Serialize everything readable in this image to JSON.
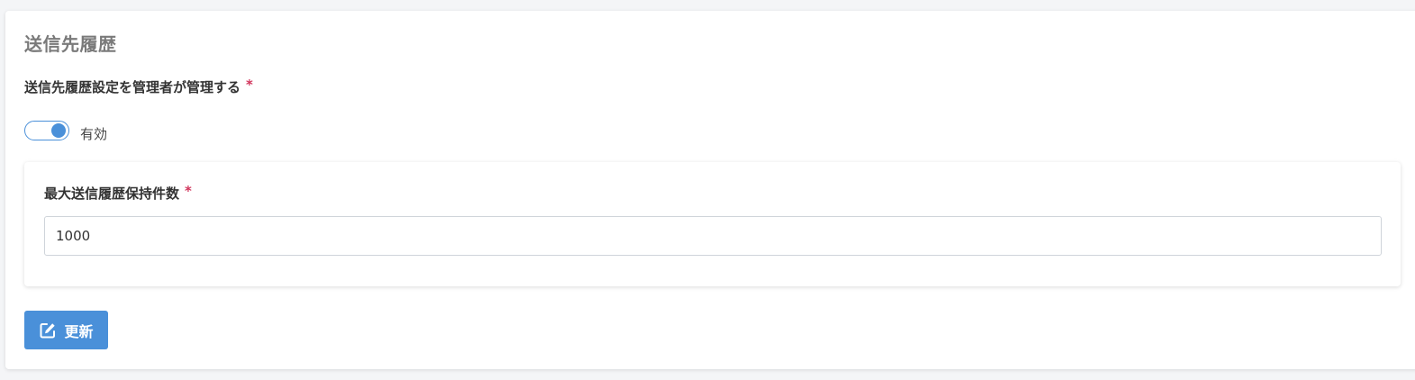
{
  "section": {
    "title": "送信先履歴"
  },
  "admin_manage": {
    "label": "送信先履歴設定を管理者が管理する",
    "required_mark": "*",
    "toggle_on": true,
    "toggle_label": "有効"
  },
  "max_history": {
    "label": "最大送信履歴保持件数",
    "required_mark": "*",
    "value": "1000"
  },
  "actions": {
    "update_label": "更新"
  },
  "colors": {
    "accent": "#4a90d9",
    "required": "#d1345b",
    "title_gray": "#7a7a7a"
  },
  "icons": {
    "update": "edit-icon"
  }
}
